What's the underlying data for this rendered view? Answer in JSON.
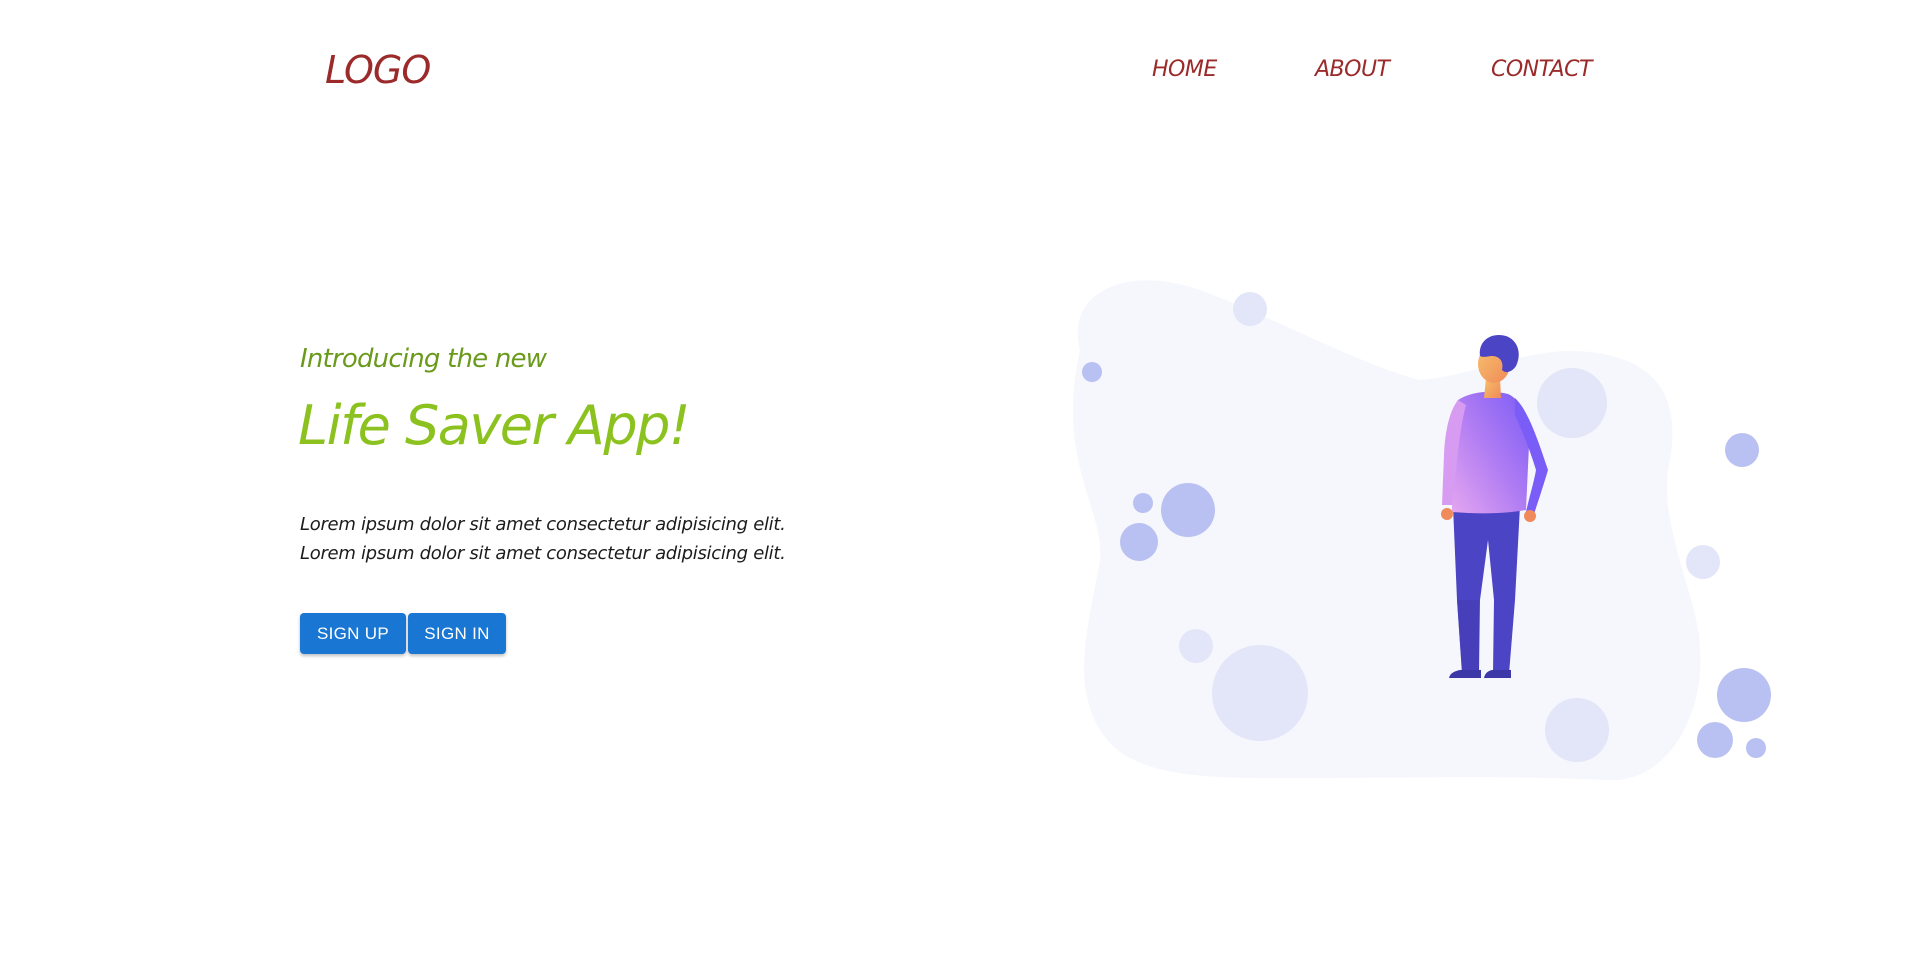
{
  "header": {
    "logo": "LOGO",
    "nav": {
      "home": "HOME",
      "about": "ABOUT",
      "contact": "CONTACT"
    }
  },
  "hero": {
    "intro": "Introducing the new",
    "headline": "Life Saver App!",
    "description_lines": [
      "Lorem ipsum dolor sit amet consectetur adipisicing elit.",
      "Lorem ipsum dolor sit amet consectetur adipisicing elit."
    ],
    "buttons": {
      "sign_up": "SIGN UP",
      "sign_in": "SIGN IN"
    }
  },
  "colors": {
    "nav_text": "#9b2a2a",
    "intro_text": "#6a9a1c",
    "headline_text": "#8cc21f",
    "button_bg": "#1976d2",
    "blob": "#f6f7fc",
    "bubble_light": "#e3e6f8",
    "bubble_mid": "#b9c1f2",
    "person_shirt": "#9b6cf5",
    "person_pants": "#4b44c4"
  },
  "illustration": {
    "icon": "person-looking-up-illustration"
  }
}
